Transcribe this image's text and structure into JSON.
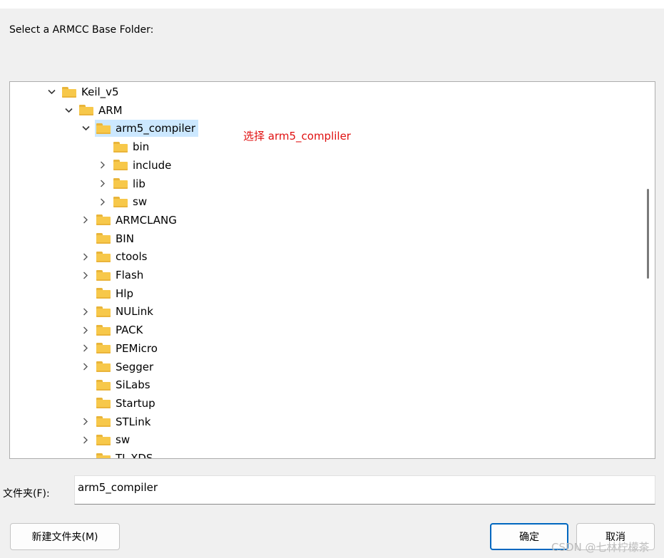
{
  "prompt": "Select a ARMCC Base Folder:",
  "tree": {
    "items": [
      {
        "label": "Keil_v5",
        "indent": 0,
        "expander": "expanded",
        "selected": false
      },
      {
        "label": "ARM",
        "indent": 1,
        "expander": "expanded",
        "selected": false
      },
      {
        "label": "arm5_compiler",
        "indent": 2,
        "expander": "expanded",
        "selected": true
      },
      {
        "label": "bin",
        "indent": 3,
        "expander": "none",
        "selected": false
      },
      {
        "label": "include",
        "indent": 3,
        "expander": "collapsed",
        "selected": false
      },
      {
        "label": "lib",
        "indent": 3,
        "expander": "collapsed",
        "selected": false
      },
      {
        "label": "sw",
        "indent": 3,
        "expander": "collapsed",
        "selected": false
      },
      {
        "label": "ARMCLANG",
        "indent": 2,
        "expander": "collapsed",
        "selected": false
      },
      {
        "label": "BIN",
        "indent": 2,
        "expander": "none",
        "selected": false
      },
      {
        "label": "ctools",
        "indent": 2,
        "expander": "collapsed",
        "selected": false
      },
      {
        "label": "Flash",
        "indent": 2,
        "expander": "collapsed",
        "selected": false
      },
      {
        "label": "Hlp",
        "indent": 2,
        "expander": "none",
        "selected": false
      },
      {
        "label": "NULink",
        "indent": 2,
        "expander": "collapsed",
        "selected": false
      },
      {
        "label": "PACK",
        "indent": 2,
        "expander": "collapsed",
        "selected": false
      },
      {
        "label": "PEMicro",
        "indent": 2,
        "expander": "collapsed",
        "selected": false
      },
      {
        "label": "Segger",
        "indent": 2,
        "expander": "collapsed",
        "selected": false
      },
      {
        "label": "SiLabs",
        "indent": 2,
        "expander": "none",
        "selected": false
      },
      {
        "label": "Startup",
        "indent": 2,
        "expander": "none",
        "selected": false
      },
      {
        "label": "STLink",
        "indent": 2,
        "expander": "collapsed",
        "selected": false
      },
      {
        "label": "sw",
        "indent": 2,
        "expander": "collapsed",
        "selected": false
      },
      {
        "label": "TI_XDS",
        "indent": 2,
        "expander": "none",
        "selected": false
      }
    ]
  },
  "annotation": "选择 arm5_compliler",
  "folder_field": {
    "label": "文件夹(F):",
    "value": "arm5_compiler"
  },
  "buttons": {
    "new_folder": "新建文件夹(M)",
    "ok": "确定",
    "cancel": "取消"
  },
  "watermark": "CSDN @七林柠檬茶",
  "colors": {
    "selection": "#cce8ff",
    "annotation": "#e01010",
    "primary_button_border": "#0067c0",
    "folder": "#f7c84a"
  },
  "icons": {
    "folder": "folder-icon",
    "expanded": "chevron-down-icon",
    "collapsed": "chevron-right-icon"
  }
}
